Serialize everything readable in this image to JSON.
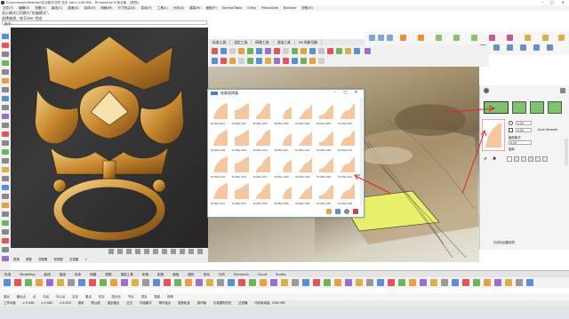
{
  "titlebar": {
    "title": "D:\\yanlianjie\\Desktop\\拉手欧式花件 拉手.3dm (158 MB) - Rhinoceros 6 商业版 - [透视]",
    "minimize": "–",
    "maximize": "□",
    "close": "✕"
  },
  "menubar": [
    "文件(F)",
    "编辑(E)",
    "查看(V)",
    "曲线(C)",
    "曲面(S)",
    "实体(O)",
    "网格(M)",
    "尺寸标注(D)",
    "变动(T)",
    "工具(L)",
    "分析(A)",
    "渲染(R)",
    "面板(P)",
    "SectionTools",
    "V-Ray",
    "RhinoGold",
    "BuhGen",
    "说明(H)"
  ],
  "command": {
    "line1": "显示模式已切换为\"抗锯模式\"。",
    "line2": "选择曲线，按 Enter 完成",
    "prompt": "指令："
  },
  "tabs": [
    "标准工具",
    "设定工具",
    "网格工具",
    "渲染工具",
    "V6 的新功能"
  ],
  "dialog": {
    "title": "轮廓选择器",
    "min": "–",
    "max": "□",
    "close": "✕",
    "items": [
      "Profile 001",
      "Profile 002",
      "Profile 003",
      "Profile 004",
      "Profile 005",
      "Profile 006",
      "Profile 007",
      "Profile 008",
      "Profile 009",
      "Profile 010",
      "Profile 011",
      "Profile 012",
      "Profile 013",
      "Profile 014",
      "Profile 015",
      "Profile 016",
      "Profile 017",
      "Profile 018",
      "Profile 019",
      "Profile 020",
      "Profile 021",
      "Profile 022",
      "Profile 023",
      "Profile 024",
      "Profile 025",
      "Profile 026",
      "Profile 027",
      "Profile 028"
    ]
  },
  "rpanel": {
    "value_a": "0.00",
    "value_b": "0.00",
    "value_c": "0.00",
    "label_a": "缩放模式",
    "label_b": "旋转",
    "label_auto": "Auto Smooth",
    "button": "已成功创建轮廓",
    "swatch_colors": [
      "#ffffff",
      "#f7d9b0",
      "#d3e8f7",
      "#e9cde8",
      "#e6e6e6",
      "#fbe3c4"
    ]
  },
  "lowtabs": [
    "视角",
    "透视",
    "顶视图",
    "前视图",
    "右视图",
    "+"
  ],
  "bottomtabs": [
    "标准",
    "Modelling",
    "曲线",
    "曲面",
    "实体",
    "网格",
    "视图",
    "渲染工具",
    "布局",
    "制造",
    "面板",
    "图形",
    "变动",
    "分析",
    "Elements",
    "Cloud",
    "Studio"
  ],
  "osnap": [
    "端点",
    "最近点",
    "点",
    "中点",
    "中心点",
    "交点",
    "垂点",
    "切点",
    "四分点",
    "节点",
    "顶点",
    "投影",
    "停用"
  ],
  "status": {
    "cplane": "工作平面",
    "x": "x 5.946",
    "y": "y 4.982",
    "z": "z 0.000",
    "unit": "毫米",
    "layer": "默认值",
    "items": [
      "锁定格点",
      "正交",
      "平面模式",
      "物件锁点",
      "智慧轨迹",
      "操作轴",
      "记录建构历史",
      "过滤器",
      "内存使用量: 2340 MB"
    ]
  },
  "colors": {
    "accent_red": "#e3232b",
    "profile_fill": "#f5c7a0",
    "yellow_selection": "#e8f06a"
  }
}
